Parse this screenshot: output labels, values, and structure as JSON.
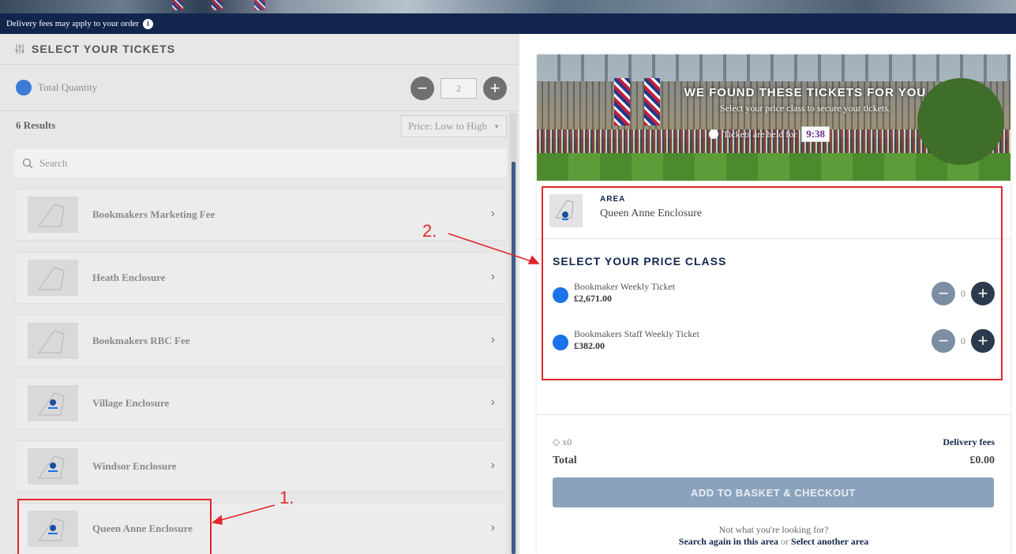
{
  "banner": {
    "delivery_text": "Delivery fees may apply to your order"
  },
  "left": {
    "header": "SELECT YOUR TICKETS",
    "quantity": {
      "label": "Total Quantity",
      "value": "2",
      "minus": "−",
      "plus": "+"
    },
    "results": "6 Results",
    "sort": {
      "selected": "Price: Low to High"
    },
    "search": {
      "placeholder": "Search"
    },
    "areas": [
      {
        "name": "Bookmakers Marketing Fee",
        "highlight": false
      },
      {
        "name": "Heath Enclosure",
        "highlight": false
      },
      {
        "name": "Bookmakers RBC Fee",
        "highlight": false
      },
      {
        "name": "Village Enclosure",
        "highlight": true
      },
      {
        "name": "Windsor Enclosure",
        "highlight": true
      },
      {
        "name": "Queen Anne Enclosure",
        "highlight": true
      }
    ],
    "chevron": "›"
  },
  "annotations": {
    "one": "1.",
    "two": "2."
  },
  "right": {
    "hero": {
      "title": "WE FOUND THESE TICKETS FOR YOU",
      "subtitle": "Select your price class to secure your tickets.",
      "held_text": "Tickets are held for",
      "timer": "9:38"
    },
    "area": {
      "tag": "AREA",
      "name": "Queen Anne Enclosure"
    },
    "price_heading": "SELECT YOUR PRICE CLASS",
    "price_classes": [
      {
        "name": "Bookmaker Weekly Ticket",
        "price": "£2,671.00",
        "count": "0"
      },
      {
        "name": "Bookmakers Staff Weekly Ticket",
        "price": "£382.00",
        "count": "0"
      }
    ],
    "tickets_count": "x0",
    "delivery_fees": "Delivery fees",
    "total_label": "Total",
    "total_value": "£0.00",
    "checkout": "ADD TO BASKET & CHECKOUT",
    "not_looking": "Not what you're looking for?",
    "search_again": "Search again in this area",
    "or": "or",
    "select_another": "Select another area"
  },
  "colors": {
    "navy": "#12264d",
    "accent_blue": "#1a73e8",
    "annotation_red": "#e0262a",
    "checkout_disabled": "#8ba2bc"
  }
}
